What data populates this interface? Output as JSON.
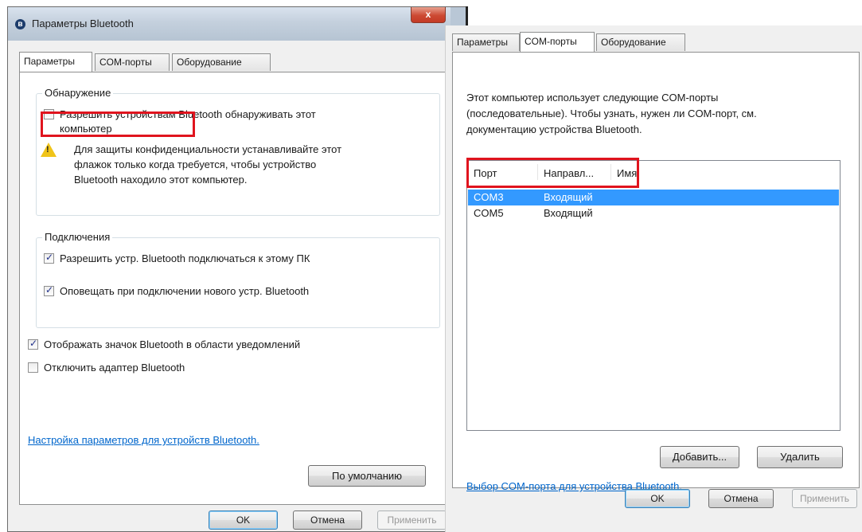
{
  "left_window": {
    "title": "Параметры Bluetooth",
    "close_glyph": "x",
    "tabs": [
      {
        "label": "Параметры",
        "active": true
      },
      {
        "label": "COM-порты",
        "active": false
      },
      {
        "label": "Оборудование",
        "active": false
      }
    ],
    "discovery": {
      "group_title": "Обнаружение",
      "allow_discovery_label_line1": "Разрешить устройствам Bluetooth обнаруживать этот",
      "allow_discovery_label_line2": "компьютер",
      "allow_discovery_checked": false,
      "warning_line1": "Для защиты конфиденциальности устанавливайте этот",
      "warning_line2": "флажок только когда требуется, чтобы устройство",
      "warning_line3": "Bluetooth находило этот компьютер."
    },
    "connections": {
      "group_title": "Подключения",
      "allow_connect_label": "Разрешить устр. Bluetooth подключаться к этому ПК",
      "allow_connect_checked": true,
      "notify_label": "Оповещать при подключении нового устр. Bluetooth",
      "notify_checked": true
    },
    "show_icon_label": "Отображать значок Bluetooth в области уведомлений",
    "show_icon_checked": true,
    "disable_adapter_label": "Отключить адаптер Bluetooth",
    "disable_adapter_checked": false,
    "settings_link": "Настройка параметров для устройств Bluetooth.",
    "defaults_button": "По умолчанию",
    "ok_button": "OK",
    "cancel_button": "Отмена",
    "apply_button": "Применить"
  },
  "right_window": {
    "tabs": [
      {
        "label": "Параметры",
        "active": false
      },
      {
        "label": "COM-порты",
        "active": true
      },
      {
        "label": "Оборудование",
        "active": false
      }
    ],
    "description_line1": "Этот компьютер использует следующие COM-порты",
    "description_line2": "(последовательные). Чтобы узнать, нужен ли COM-порт, см.",
    "description_line3": "документацию устройства Bluetooth.",
    "columns": [
      "Порт",
      "Направл...",
      "Имя"
    ],
    "rows": [
      {
        "port": "COM3",
        "direction": "Входящий",
        "name": "",
        "selected": true
      },
      {
        "port": "COM5",
        "direction": "Входящий",
        "name": "",
        "selected": false
      }
    ],
    "add_button": "Добавить...",
    "remove_button": "Удалить",
    "select_link": "Выбор COM-порта для устройства Bluetooth.",
    "ok_button": "OK",
    "cancel_button": "Отмена",
    "apply_button": "Применить"
  },
  "colors": {
    "highlight": "#e0141e",
    "selection": "#3399ff",
    "link": "#0066cc"
  }
}
